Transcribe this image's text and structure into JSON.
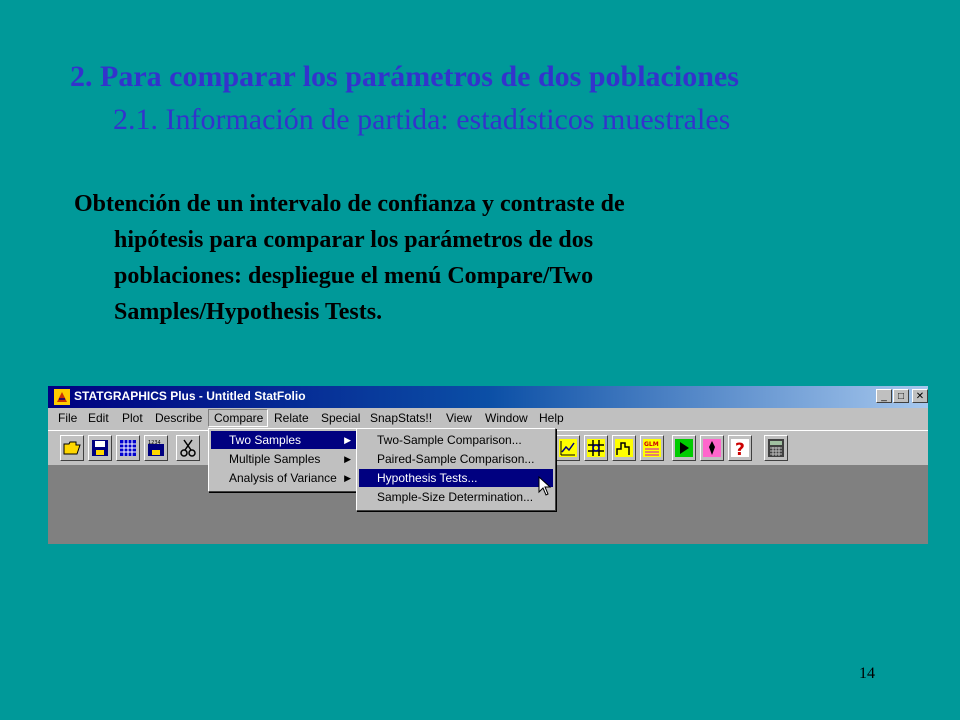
{
  "slide": {
    "title": "2. Para comparar los parámetros de dos poblaciones",
    "subtitle": "2.1. Información de partida: estadísticos muestrales",
    "body_lines": [
      "Obtención de un intervalo de confianza y contraste de",
      "hipótesis para comparar los parámetros de dos",
      "poblaciones: despliegue el menú Compare/Two",
      "Samples/Hypothesis Tests."
    ],
    "page_number": "14"
  },
  "app": {
    "window_title": "STATGRAPHICS Plus - Untitled StatFolio",
    "window_controls": [
      "_",
      "□",
      "✕"
    ],
    "menu": [
      "File",
      "Edit",
      "Plot",
      "Describe",
      "Compare",
      "Relate",
      "Special",
      "SnapStats!!",
      "View",
      "Window",
      "Help"
    ],
    "open_menu": "Compare",
    "compare_menu": [
      {
        "label": "Two Samples",
        "has_submenu": true,
        "active": true
      },
      {
        "label": "Multiple Samples",
        "has_submenu": true,
        "active": false
      },
      {
        "label": "Analysis of Variance",
        "has_submenu": true,
        "active": false
      }
    ],
    "two_samples_submenu": [
      {
        "label": "Two-Sample Comparison...",
        "active": false
      },
      {
        "label": "Paired-Sample Comparison...",
        "active": false
      },
      {
        "label": "Hypothesis Tests...",
        "active": true
      },
      {
        "label": "Sample-Size Determination...",
        "active": false
      }
    ],
    "toolbar_icons": [
      "open-folder-icon",
      "save-icon",
      "spreadsheet-icon",
      "save-data-icon",
      "scissors-icon",
      "line-chart-icon",
      "scatter-grid-icon",
      "step-chart-icon",
      "glm-icon",
      "green-play-icon",
      "pink-gear-icon",
      "question-mark-icon",
      "calculator-icon"
    ],
    "toolbar_glyph_labels": {
      "data": "1234",
      "glm": "GLM"
    }
  },
  "colors": {
    "slide_background": "#009999",
    "title": "#3333cc",
    "menu_highlight": "#000080",
    "workspace": "#808080"
  }
}
